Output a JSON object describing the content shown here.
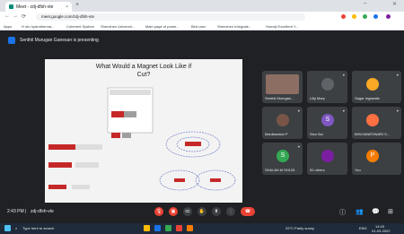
{
  "browser": {
    "tab_title": "Meet - zdj-dfsh-vte",
    "tab_close": "×",
    "new_tab": "+",
    "url": "meet.google.com/zdj-dfsh-vte",
    "win_minimize": "–",
    "win_close": "✕"
  },
  "bookmarks": [
    {
      "label": "Apps"
    },
    {
      "label": "H ofu hydrotherma..."
    },
    {
      "label": "Coherent System"
    },
    {
      "label": "Shenzhen Universit..."
    },
    {
      "label": "Main page of poem..."
    },
    {
      "label": "Bird user"
    },
    {
      "label": "Shenzhen Integrate..."
    },
    {
      "label": "Homeji Excellent Y..."
    }
  ],
  "presenting": {
    "text": "Senthil Murugan Ganesan is presenting"
  },
  "slide": {
    "title_line1": "What Would a Magnet Look Like if",
    "title_line2": "Cut?"
  },
  "participants": [
    {
      "name": "Senthil Murugan...",
      "initial": "",
      "color": "#8d6e63"
    },
    {
      "name": "Lilly Mary",
      "initial": "",
      "color": "#5f6368"
    },
    {
      "name": "Sagar Ingawale",
      "initial": "",
      "color": "#f9a825"
    },
    {
      "name": "Manikandan P",
      "initial": "",
      "color": "#795548"
    },
    {
      "name": "Siva Sai",
      "initial": "S",
      "color": "#7e57c2"
    },
    {
      "name": "BHUVANESWARI S...",
      "initial": "",
      "color": "#ff7043"
    },
    {
      "name": "SHALINI M SH125",
      "initial": "S",
      "color": "#34a853"
    },
    {
      "name": "92 others",
      "initial": "",
      "color": "#7b1fa2"
    },
    {
      "name": "You",
      "initial": "P",
      "color": "#f57c00"
    }
  ],
  "meeting": {
    "time": "2:43 PM",
    "code": "zdj-dfsh-vte"
  },
  "taskbar": {
    "search_placeholder": "Type here to search",
    "weather": "29°C Partly sunny",
    "lang": "ENG",
    "clock_time": "14:43",
    "clock_date": "01-03-2022"
  }
}
